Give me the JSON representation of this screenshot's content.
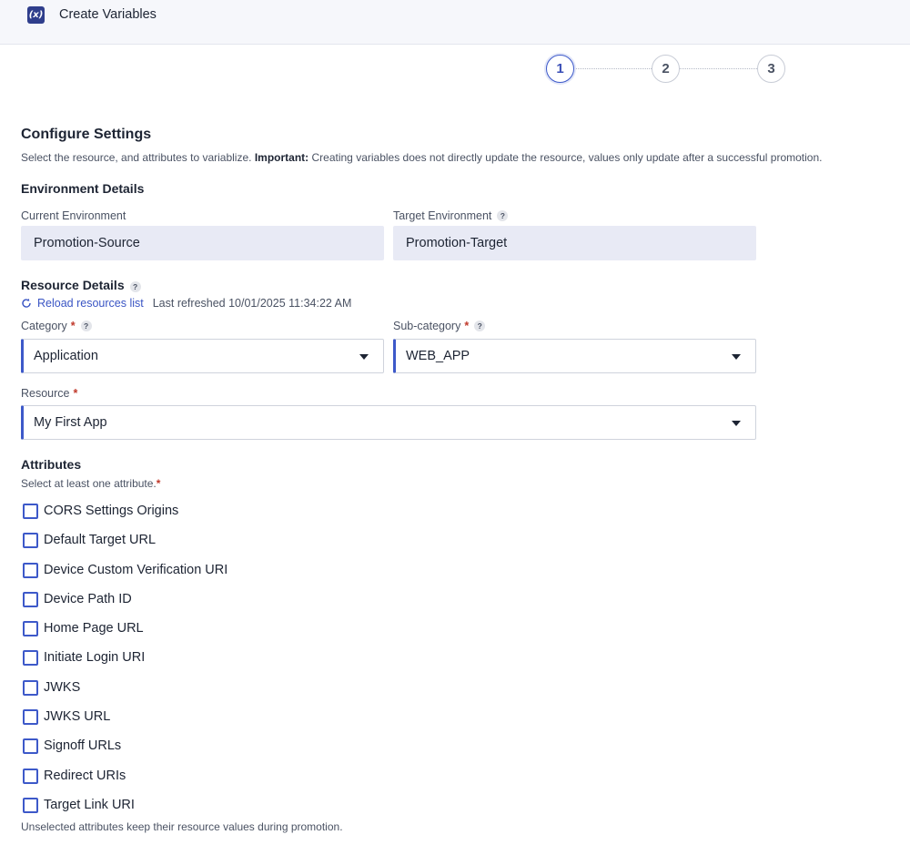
{
  "app": {
    "title": "Create Variables",
    "icon": "variable-icon",
    "icon_glyph": "(x)"
  },
  "stepper": {
    "steps": [
      "1",
      "2",
      "3"
    ],
    "active": 0
  },
  "configure": {
    "title": "Configure Settings",
    "description_prefix": "Select the resource, and attributes to variablize.",
    "description_important": "Important:",
    "description_suffix": "Creating variables does not directly update the resource, values only update after a successful promotion."
  },
  "environment": {
    "title": "Environment Details",
    "current_label": "Current Environment",
    "current_value": "Promotion-Source",
    "target_label": "Target Environment",
    "target_value": "Promotion-Target"
  },
  "resource": {
    "title": "Resource Details",
    "reload_label": "Reload resources list",
    "last_refreshed": "Last refreshed 10/01/2025 11:34:22 AM",
    "category_label": "Category",
    "category_value": "Application",
    "subcategory_label": "Sub-category",
    "subcategory_value": "WEB_APP",
    "resource_label": "Resource",
    "resource_value": "My First App",
    "required_mark": "*",
    "help_mark": "?"
  },
  "attributes": {
    "title": "Attributes",
    "hint": "Select at least one attribute.",
    "items": [
      {
        "label": "CORS Settings Origins",
        "checked": false
      },
      {
        "label": "Default Target URL",
        "checked": false
      },
      {
        "label": "Device Custom Verification URI",
        "checked": false
      },
      {
        "label": "Device Path ID",
        "checked": false
      },
      {
        "label": "Home Page URL",
        "checked": false
      },
      {
        "label": "Initiate Login URI",
        "checked": false
      },
      {
        "label": "JWKS",
        "checked": false
      },
      {
        "label": "JWKS URL",
        "checked": false
      },
      {
        "label": "Signoff URLs",
        "checked": false
      },
      {
        "label": "Redirect URIs",
        "checked": false
      },
      {
        "label": "Target Link URI",
        "checked": false
      }
    ],
    "footer_note": "Unselected attributes keep their resource values during promotion."
  },
  "colors": {
    "accent": "#3d59c9",
    "field_bg": "#e8eaf5",
    "required": "#c0392b"
  }
}
